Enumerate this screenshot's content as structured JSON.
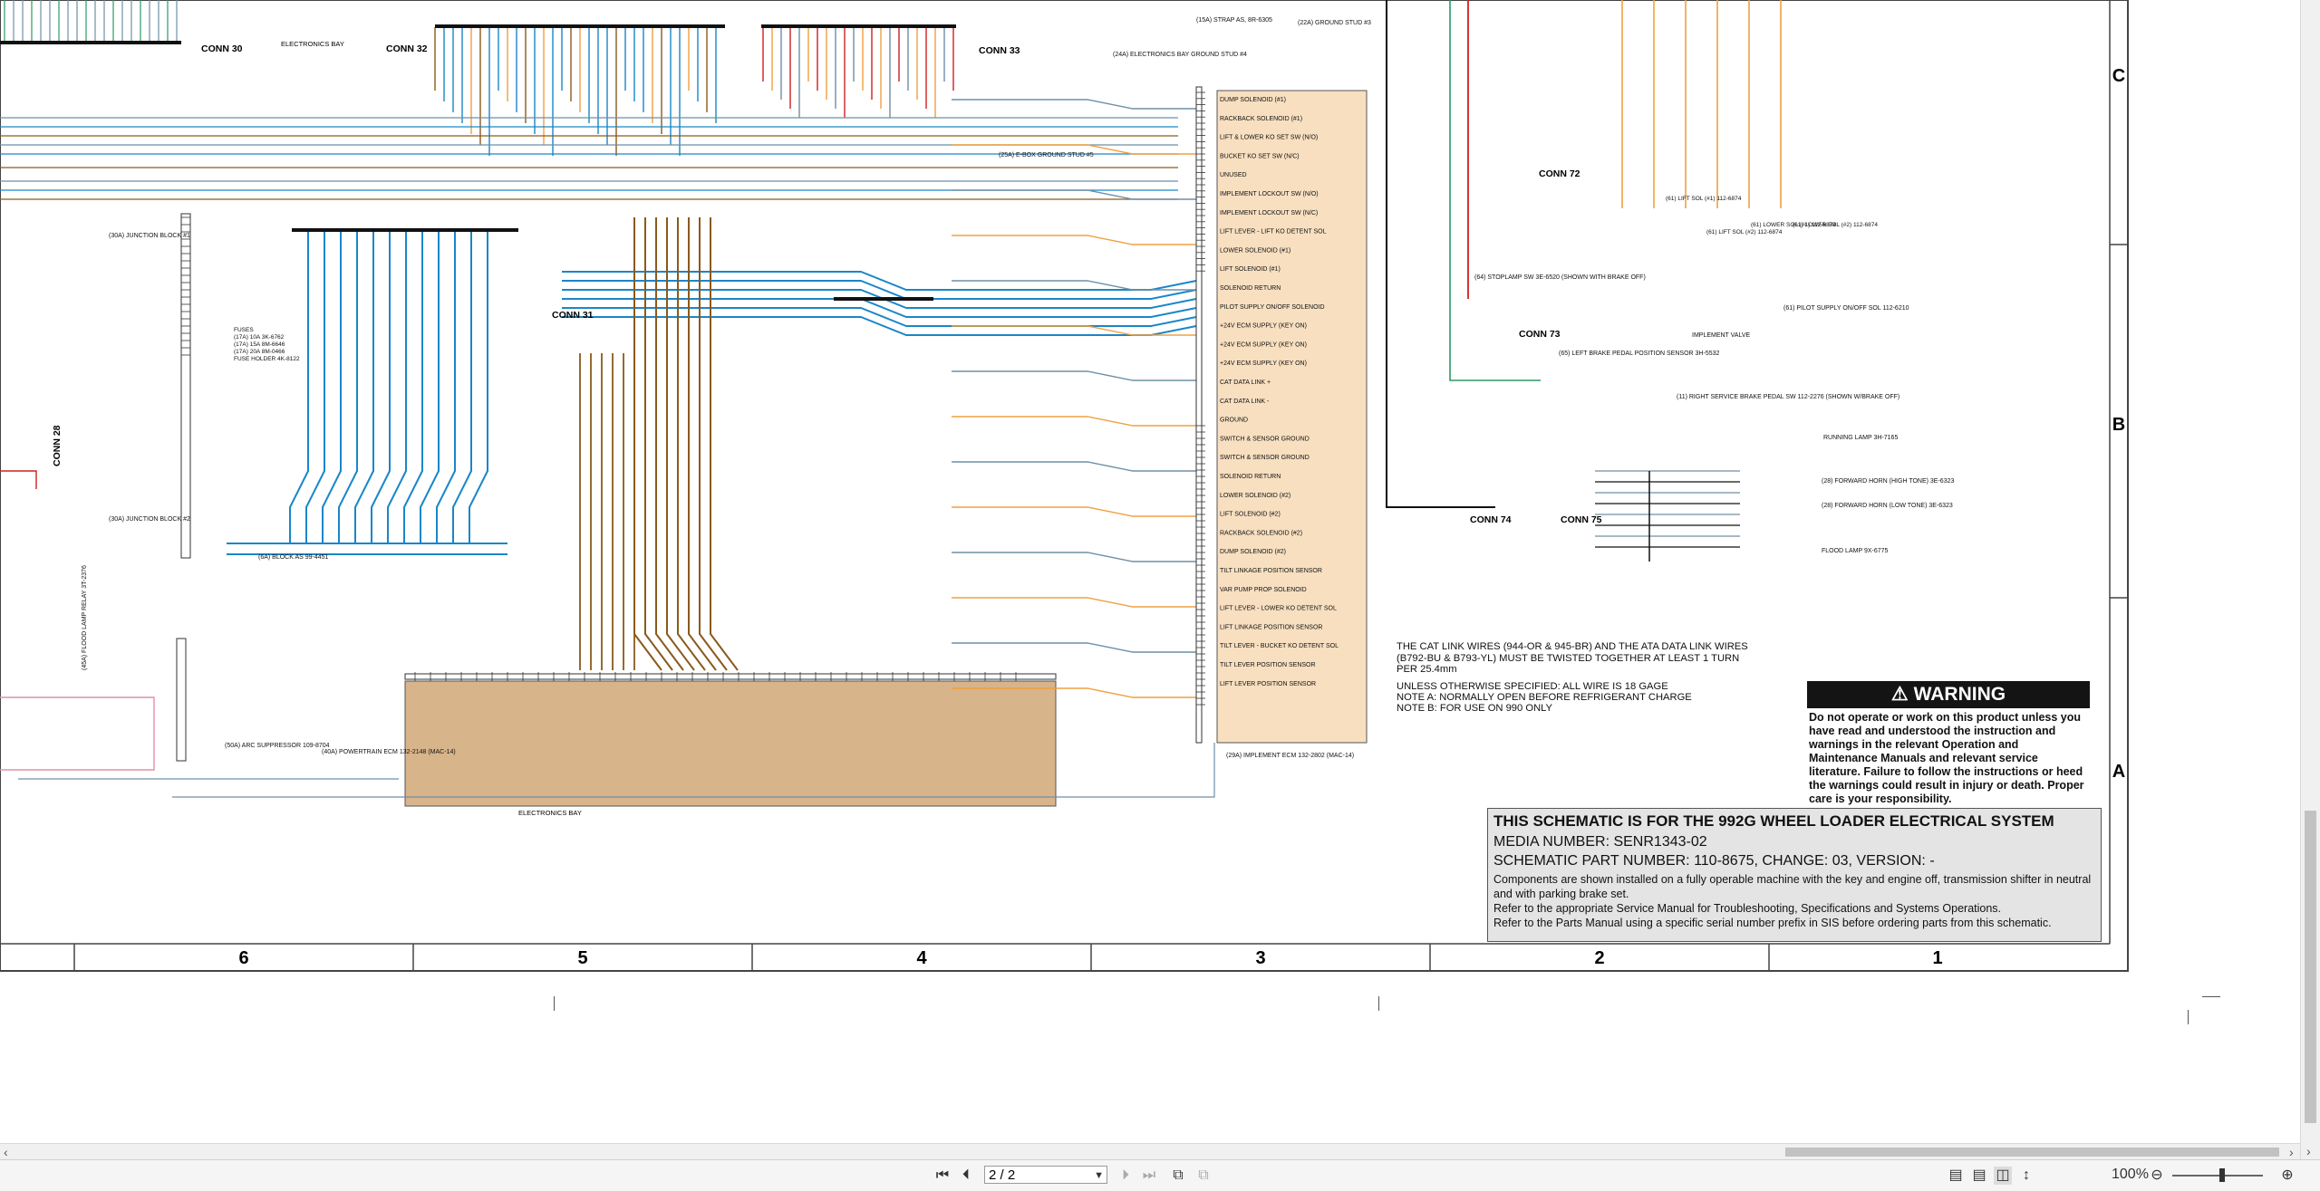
{
  "schematic": {
    "connectors": [
      "CONN 30",
      "CONN 32",
      "CONN 33",
      "CONN 31",
      "CONN 28",
      "CONN 72",
      "CONN 73",
      "CONN 74",
      "CONN 75"
    ],
    "bay_labels": [
      "ELECTRONICS BAY",
      "ELECTRONICS BAY"
    ],
    "ground_labels": [
      "(24A) ELECTRONICS BAY GROUND STUD #4",
      "(15A) STRAP AS, 8R-6305",
      "(22A) GROUND STUD #3",
      "(25A) E-BOX GROUND STUD #5"
    ],
    "ecm_labels": [
      "(29A) IMPLEMENT ECM 132-2802 (MAC-14)",
      "(40A) POWERTRAIN ECM 132-2148 (MAC-14)"
    ],
    "component_labels": [
      "(30A) JUNCTION BLOCK #1",
      "(30A) JUNCTION BLOCK #2",
      "(6A) BLOCK AS 99-4451",
      "(45A) FLOOD LAMP RELAY 3T-2376",
      "(50A) ARC SUPPRESSOR 109-8704",
      "(64) STOPLAMP SW 3E-6520 (SHOWN WITH BRAKE OFF)",
      "(65) LEFT BRAKE PEDAL POSITION SENSOR 3H-5532",
      "(11) RIGHT SERVICE BRAKE PEDAL SW 112-2276 (SHOWN W/BRAKE OFF)",
      "RUNNING LAMP 3H-7165",
      "(28) FORWARD HORN (HIGH TONE) 3E-6323",
      "(28) FORWARD HORN (LOW TONE) 3E-6323",
      "FLOOD LAMP 9X-6775",
      "(61) PILOT SUPPLY ON/OFF SOL 112-6210",
      "IMPLEMENT VALVE",
      "(61) LIFT SOL (#1) 112-6874",
      "(61) LIFT SOL (#2) 112-6874",
      "(61) LOWER SOL (#1) 112-6874",
      "(61) LOWER SOL (#2) 112-6874"
    ],
    "ecm_pin_functions": [
      "DUMP SOLENOID (#1)",
      "RACKBACK SOLENOID (#1)",
      "LIFT & LOWER KO SET SW (N/O)",
      "BUCKET KO SET SW (N/C)",
      "UNUSED",
      "IMPLEMENT LOCKOUT SW (N/O)",
      "IMPLEMENT LOCKOUT SW (N/C)",
      "LIFT LEVER - LIFT KO DETENT SOL",
      "LOWER SOLENOID (#1)",
      "LIFT SOLENOID (#1)",
      "SOLENOID RETURN",
      "PILOT SUPPLY ON/OFF SOLENOID",
      "+24V ECM SUPPLY (KEY ON)",
      "+24V ECM SUPPLY (KEY ON)",
      "+24V ECM SUPPLY (KEY ON)",
      "CAT DATA LINK +",
      "CAT DATA LINK -",
      "GROUND",
      "SWITCH & SENSOR GROUND",
      "SWITCH & SENSOR GROUND",
      "SOLENOID RETURN",
      "LOWER SOLENOID (#2)",
      "LIFT SOLENOID (#2)",
      "RACKBACK SOLENOID (#2)",
      "DUMP SOLENOID (#2)",
      "TILT LINKAGE POSITION SENSOR",
      "VAR PUMP PROP SOLENOID",
      "LIFT LEVER - LOWER KO DETENT SOL",
      "LIFT LINKAGE POSITION SENSOR",
      "TILT LEVER - BUCKET KO DETENT SOL",
      "TILT LEVER POSITION SENSOR",
      "LIFT LEVER POSITION SENSOR"
    ],
    "fuse_block": [
      "FUSES",
      "(17A) 10A 3K-6762",
      "(17A) 15A 8M-6646",
      "(17A) 20A 8M-0466",
      "FUSE HOLDER 4K-8122"
    ],
    "grid_columns": [
      "6",
      "5",
      "4",
      "3",
      "2",
      "1"
    ],
    "grid_rows": [
      "C",
      "B",
      "A"
    ],
    "notes": [
      "THE CAT LINK WIRES (944-OR & 945-BR) AND THE ATA DATA LINK WIRES (B792-BU & B793-YL) MUST BE TWISTED TOGETHER AT LEAST 1 TURN PER 25.4mm",
      "UNLESS OTHERWISE SPECIFIED: ALL WIRE IS 18 GAGE",
      "NOTE A: NORMALLY OPEN BEFORE REFRIGERANT CHARGE",
      "NOTE B: FOR USE ON 990 ONLY"
    ],
    "warning": {
      "title": "WARNING",
      "text": "Do not operate or work on this product unless you have read and understood the instruction and warnings in the relevant Operation and Maintenance Manuals and relevant service literature. Failure to follow the instructions or heed the warnings could result in injury or death. Proper care is your responsibility."
    },
    "title_block": {
      "line1": "THIS SCHEMATIC IS FOR THE 992G WHEEL LOADER ELECTRICAL SYSTEM",
      "line2": "MEDIA NUMBER: SENR1343-02",
      "line3": "SCHEMATIC PART NUMBER: 110-8675, CHANGE: 03, VERSION: -",
      "line4": "Components are shown installed on a fully operable machine with the key and engine off, transmission shifter in neutral and with parking brake set.",
      "line5": "Refer to the appropriate Service Manual for Troubleshooting, Specifications and Systems Operations.",
      "line6": "Refer to the Parts Manual using a specific serial number prefix in SIS before ordering parts from this schematic."
    }
  },
  "toolbar": {
    "page_value": "2 / 2",
    "zoom": "100%"
  },
  "colors": {
    "wire_blue": "#1a86c8",
    "wire_brown": "#8a5a1c",
    "wire_orange": "#f0a040",
    "wire_gray": "#6f8fa6",
    "wire_black": "#111111",
    "wire_green": "#2a9a6a",
    "wire_red": "#d02020",
    "wire_pink": "#e090a8",
    "ecm_fill": "#f7dfc0",
    "powertrain_fill": "#d8b48a"
  }
}
